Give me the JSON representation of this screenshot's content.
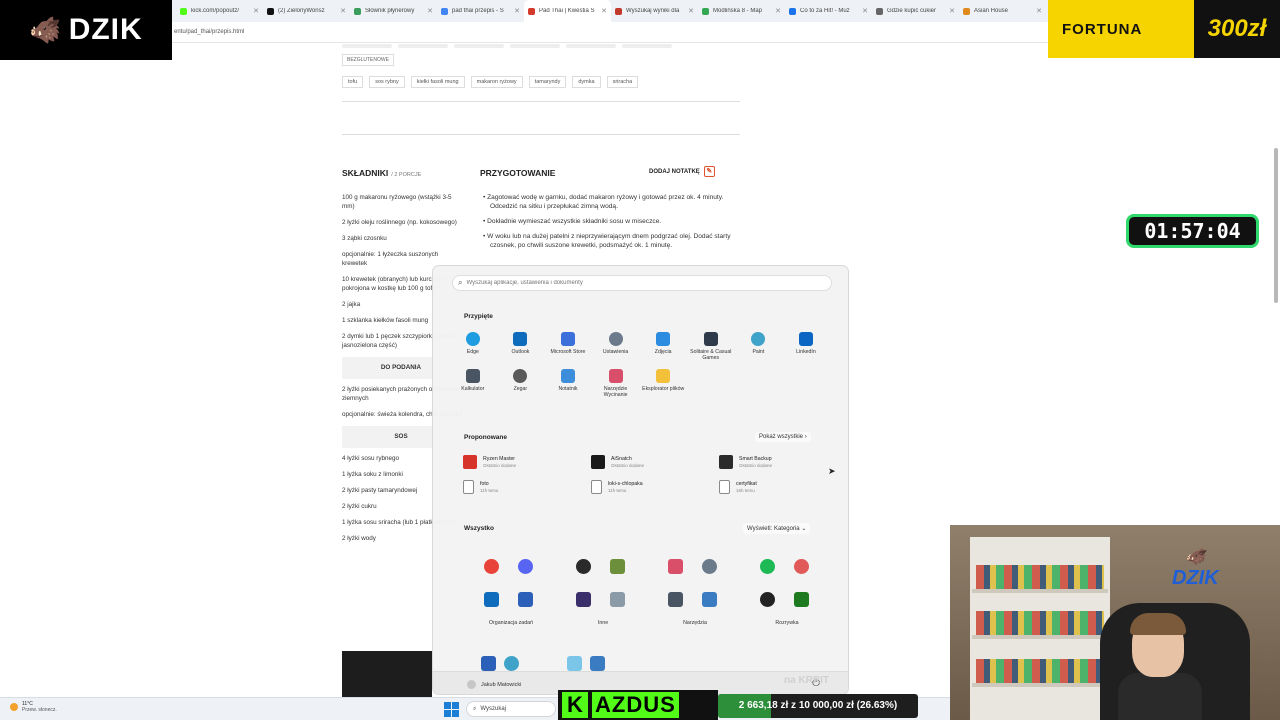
{
  "browser": {
    "tabs": [
      {
        "title": "kick.com/popoutz/",
        "color": "#53fc18"
      },
      {
        "title": "(2) ZielonyWonsz",
        "color": "#111111"
      },
      {
        "title": "Słownik płynerowy",
        "color": "#3a9d5d"
      },
      {
        "title": "pad thai przepis - S",
        "color": "#4285f4"
      },
      {
        "title": "Pad Thai | Kwestia S",
        "color": "#d33a2c",
        "active": true
      },
      {
        "title": "Wyszukaj wyniki dla",
        "color": "#c0392b"
      },
      {
        "title": "Modlińska 8 - Map",
        "color": "#34a853"
      },
      {
        "title": "Co to za Hit! - Muz",
        "color": "#1a73e8"
      },
      {
        "title": "Gdzie kupić cukier",
        "color": "#666666"
      },
      {
        "title": "Asian House",
        "color": "#e08a1e"
      }
    ],
    "url": "entu/pad_thai/przepis.html"
  },
  "overlays": {
    "logo": "DZIK",
    "fortuna_name": "FORTUNA",
    "fortuna_amount": "300zł",
    "timer": "01:57:04",
    "kick_letter": "K",
    "kick_name": "AZDUS",
    "goal_text": "2 663,18 zł z 10 000,00 zł (26.63%)",
    "goal_fraction": 0.2663,
    "watermark": "na KRRIT",
    "cam_logo": "DZIK"
  },
  "recipe": {
    "tag_glutenfree": "BEZGLUTENOWE",
    "tags": [
      "tofu",
      "sos rybny",
      "kiełki fasoli mung",
      "makaron ryżowy",
      "tamaryndy",
      "dymka",
      "sriracha"
    ],
    "ingredients_title": "SKŁADNIKI",
    "portions": "/ 2 PORCJE",
    "ingredients": [
      "100 g makaronu ryżowego (wstążki 3-5 mm)",
      "2 łyżki oleju roślinnego (np. kokosowego)",
      "3 ząbki czosnku",
      "opcjonalnie: 1 łyżeczka suszonych krewetek",
      "10 krewetek (obranych) lub kurczaka pokrojona w kostkę lub 100 g tofu",
      "2 jajka",
      "1 szklanka kiełków fasoli mung",
      "2 dymki lub 1 pęczek szczypiorku (biała i jasnozielona część)"
    ],
    "serving_title": "DO PODANIA",
    "serving": [
      "2 łyżki posiekanych prażonych orzeszków ziemnych",
      "opcjonalnie: świeża kolendra, chili, limonka"
    ],
    "sauce_title": "SOS",
    "sauce": [
      "4 łyżki sosu rybnego",
      "1 łyżka soku z limonki",
      "2 łyżki pasty tamaryndowej",
      "2 łyżki cukru",
      "1 łyżka sosu sriracha (lub 1 płatków chili)",
      "2 łyżki wody"
    ],
    "prep_title": "PRZYGOTOWANIE",
    "add_note": "DODAJ NOTATKĘ",
    "steps": [
      "Zagotować wodę w garnku, dodać makaron ryżowy i gotować przez ok. 4 minuty. Odcedzić na sitku i przepłukać zimną wodą.",
      "Dokładnie wymieszać wszystkie składniki sosu w miseczce.",
      "W woku lub na dużej patelni z nieprzywierającym dnem podgrzać olej. Dodać starty czosnek, po chwili suszone krewetki, podsmażyć ok. 1 minutę."
    ]
  },
  "start_menu": {
    "search_placeholder": "Wyszukaj aplikacje, ustawienia i dokumenty",
    "pinned_title": "Przypięte",
    "pinned": [
      {
        "label": "Edge",
        "color": "#1f9de0",
        "icon": "edge-icon",
        "round": true
      },
      {
        "label": "Outlook",
        "color": "#0f6cbd",
        "icon": "outlook-icon"
      },
      {
        "label": "Microsoft Store",
        "color": "#3b6fd9",
        "icon": "store-icon"
      },
      {
        "label": "Ustawienia",
        "color": "#6b7b8c",
        "icon": "settings-icon",
        "round": true
      },
      {
        "label": "Zdjęcia",
        "color": "#2b8ce0",
        "icon": "photos-icon"
      },
      {
        "label": "Solitaire & Casual Games",
        "color": "#2f3b4a",
        "icon": "solitaire-icon"
      },
      {
        "label": "Paint",
        "color": "#3fa3c9",
        "icon": "paint-icon",
        "round": true
      },
      {
        "label": "LinkedIn",
        "color": "#0a66c2",
        "icon": "linkedin-icon"
      },
      {
        "label": "Kalkulator",
        "color": "#4a5563",
        "icon": "calculator-icon"
      },
      {
        "label": "Zegar",
        "color": "#5a5a5a",
        "icon": "clock-icon",
        "round": true
      },
      {
        "label": "Notatnik",
        "color": "#3c8edb",
        "icon": "notepad-icon"
      },
      {
        "label": "Narzędzie Wycinanie",
        "color": "#d94f6a",
        "icon": "snipping-tool-icon"
      },
      {
        "label": "Eksplorator plików",
        "color": "#f3c03a",
        "icon": "file-explorer-icon"
      }
    ],
    "recommended_title": "Proponowane",
    "more_label": "Pokaż wszystkie",
    "recommended": [
      {
        "name": "Ryzen Master",
        "sub": "Ostatnio dodane",
        "color": "#d6332b",
        "icon": "ryzen-master-icon",
        "file": false
      },
      {
        "name": "AiSnatch",
        "sub": "Ostatnio dodane",
        "color": "#1a1a1a",
        "icon": "aisnatch-icon",
        "file": false
      },
      {
        "name": "Smart Backup",
        "sub": "Ostatnio dodane",
        "color": "#2b2b2b",
        "icon": "smart-backup-icon",
        "file": false
      },
      {
        "name": "foto",
        "sub": "11h temu",
        "color": "#ffffff",
        "icon": "file-icon",
        "file": true
      },
      {
        "name": "loki-s-chlopaka",
        "sub": "11h temu",
        "color": "#ffffff",
        "icon": "file-icon",
        "file": true
      },
      {
        "name": "certyfikat",
        "sub": "16h temu",
        "color": "#ffffff",
        "icon": "file-icon",
        "file": true
      }
    ],
    "all_title": "Wszystko",
    "view_label": "Wyświetl: Kategoria",
    "folders": [
      {
        "label": "Organizacja zadań",
        "apps": [
          {
            "icon": "chrome-icon",
            "color": "#e8443a",
            "round": true
          },
          {
            "icon": "discord-icon",
            "color": "#5865f2",
            "round": true
          },
          {
            "icon": "outlook-icon",
            "color": "#0f6cbd",
            "round": false
          },
          {
            "icon": "todo-icon",
            "color": "#2b5fb8",
            "round": false
          }
        ]
      },
      {
        "label": "Inne",
        "apps": [
          {
            "icon": "obs-icon",
            "color": "#2a2a2a",
            "round": true
          },
          {
            "icon": "minecraft-icon",
            "color": "#6b8f3a",
            "round": false
          },
          {
            "icon": "app-icon",
            "color": "#3a2f6b",
            "round": false
          },
          {
            "icon": "game-icon",
            "color": "#8a9aa6",
            "round": false
          }
        ]
      },
      {
        "label": "Narzędzia",
        "apps": [
          {
            "icon": "snipping-tool-icon",
            "color": "#d94f6a",
            "round": false
          },
          {
            "icon": "settings-icon",
            "color": "#6b7b8c",
            "round": true
          },
          {
            "icon": "calculator-icon",
            "color": "#4a5563",
            "round": false
          },
          {
            "icon": "control-panel-icon",
            "color": "#3a7cc2",
            "round": false
          }
        ]
      },
      {
        "label": "Rozrywka",
        "apps": [
          {
            "icon": "spotify-icon",
            "color": "#1db954",
            "round": true
          },
          {
            "icon": "game-icon",
            "color": "#e05a5a",
            "round": true
          },
          {
            "icon": "media-player-icon",
            "color": "#222222",
            "round": true
          },
          {
            "icon": "xbox-icon",
            "color": "#1e7a1e",
            "round": false
          }
        ]
      }
    ],
    "user_name": "Jakub Matowicki"
  },
  "taskbar": {
    "temperature": "11°C",
    "condition": "Przew. słonecz.",
    "search_label": "Wyszukaj"
  }
}
